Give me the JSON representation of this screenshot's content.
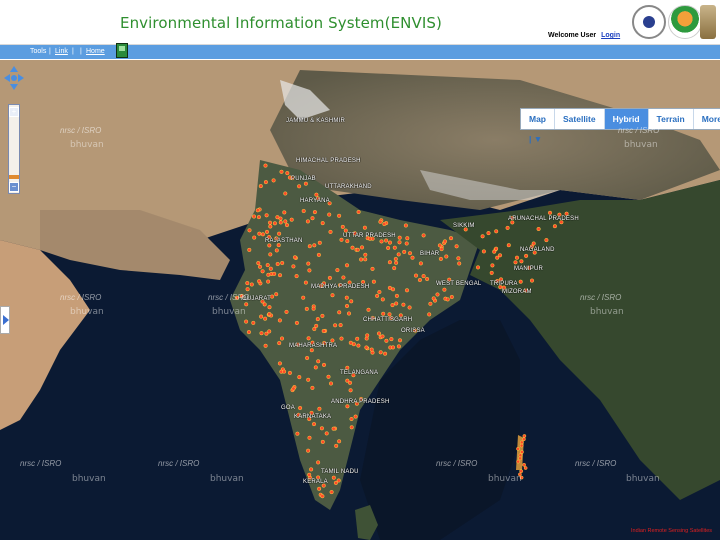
{
  "header": {
    "title": "Environmental Information System(ENVIS)",
    "welcome_text": "Welcome User",
    "login_link": "Login"
  },
  "logos": [
    "envis-logo",
    "state-emblem-logo",
    "ashoka-emblem-logo"
  ],
  "navbar": {
    "tools": "Tools",
    "separator": "|",
    "link": "Link",
    "home": "Home"
  },
  "map": {
    "controls": {
      "zoom_in": "+",
      "zoom_out": "−",
      "zoom_level": 0.8
    },
    "map_types": [
      {
        "label": "Map",
        "dropdown": "▼",
        "active": false
      },
      {
        "label": "Satellite",
        "active": false
      },
      {
        "label": "Hybrid",
        "active": true
      },
      {
        "label": "Terrain",
        "active": false
      },
      {
        "label": "More",
        "active": false
      }
    ],
    "states": [
      "JAMMU & KASHMIR",
      "HIMACHAL PRADESH",
      "PUNJAB",
      "UTTARAKHAND",
      "HARYANA",
      "RAJASTHAN",
      "UTTAR PRADESH",
      "SIKKIM",
      "ARUNACHAL PRADESH",
      "NAGALAND",
      "BIHAR",
      "MANIPUR",
      "TRIPURA",
      "MIZORAM",
      "WEST BENGAL",
      "MADHYA PRADESH",
      "GUJARAT",
      "CHHATTISGARH",
      "ORISSA",
      "MAHARASHTRA",
      "TELANGANA",
      "ANDHRA PRADESH",
      "GOA",
      "KARNATAKA",
      "TAMIL NADU",
      "KERALA"
    ],
    "watermark_text": "nrsc / ISRO",
    "bhuvan_text": "bhuvan",
    "credit": "Indian Remote Sensing Satellites",
    "colors": {
      "ocean": "#0b1a33",
      "land_desert": "#b89a78",
      "marker": "#ff4a2a",
      "navbar": "#5b9de0",
      "title": "#2f8f2f"
    }
  }
}
